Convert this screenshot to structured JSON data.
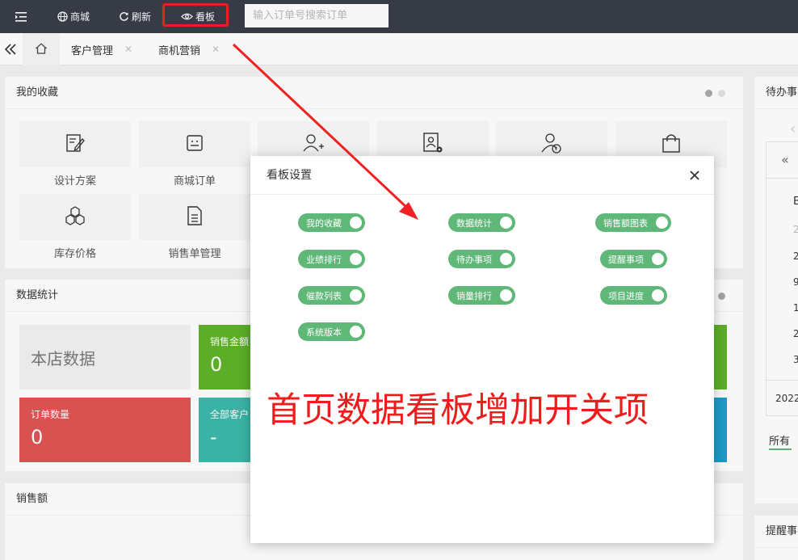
{
  "topbar": {
    "menu_icon": "menu-fold-icon",
    "items": [
      {
        "label": "商城",
        "icon": "globe-icon"
      },
      {
        "label": "刷新",
        "icon": "refresh-icon"
      },
      {
        "label": "看板",
        "icon": "eye-icon"
      }
    ],
    "search_placeholder": "输入订单号搜索订单",
    "highlight_color": "#e8261c"
  },
  "tabs": {
    "home_icon": "home-icon",
    "items": [
      {
        "label": "客户管理"
      },
      {
        "label": "商机营销"
      }
    ]
  },
  "favorites": {
    "title": "我的收藏",
    "items": [
      {
        "label": "设计方案",
        "icon": "design-plan-icon"
      },
      {
        "label": "商城订单",
        "icon": "mall-order-icon"
      },
      {
        "label": "",
        "icon": "add-user-icon"
      },
      {
        "label": "",
        "icon": "contact-settings-icon"
      },
      {
        "label": "",
        "icon": "customer-icon"
      },
      {
        "label": "",
        "icon": "shopping-bag-icon"
      },
      {
        "label": "库存价格",
        "icon": "inventory-icon"
      },
      {
        "label": "销售单管理",
        "icon": "sales-order-icon"
      }
    ]
  },
  "stats": {
    "title": "数据统计",
    "store_label": "本店数据",
    "boxes": [
      {
        "label": "销售金额",
        "value": "0",
        "color": "#5fb32a"
      },
      {
        "label": "订单数量",
        "value": "0",
        "color": "#e05454"
      },
      {
        "label": "全部客户",
        "value": "-",
        "color": "#3cb8aa"
      }
    ]
  },
  "sales": {
    "title": "销售额"
  },
  "right_panel": {
    "todo_title": "待办事",
    "calendar_partial": [
      "E",
      "2",
      "2",
      "9",
      "1",
      "2",
      "3"
    ],
    "date_partial": "2022-",
    "tab_all": "所有",
    "remind_title": "提醒事"
  },
  "modal": {
    "title": "看板设置",
    "switches": [
      {
        "label": "我的收藏",
        "on": true
      },
      {
        "label": "数据统计",
        "on": true
      },
      {
        "label": "销售额图表",
        "on": true
      },
      {
        "label": "业绩排行",
        "on": true
      },
      {
        "label": "待办事项",
        "on": true
      },
      {
        "label": "提醒事项",
        "on": true
      },
      {
        "label": "催款列表",
        "on": true
      },
      {
        "label": "销量排行",
        "on": true
      },
      {
        "label": "项目进度",
        "on": true
      },
      {
        "label": "系统版本",
        "on": true
      }
    ],
    "switch_color": "#5fb878"
  },
  "annotation": {
    "text": "首页数据看板增加开关项",
    "color": "#ee1c1c"
  }
}
